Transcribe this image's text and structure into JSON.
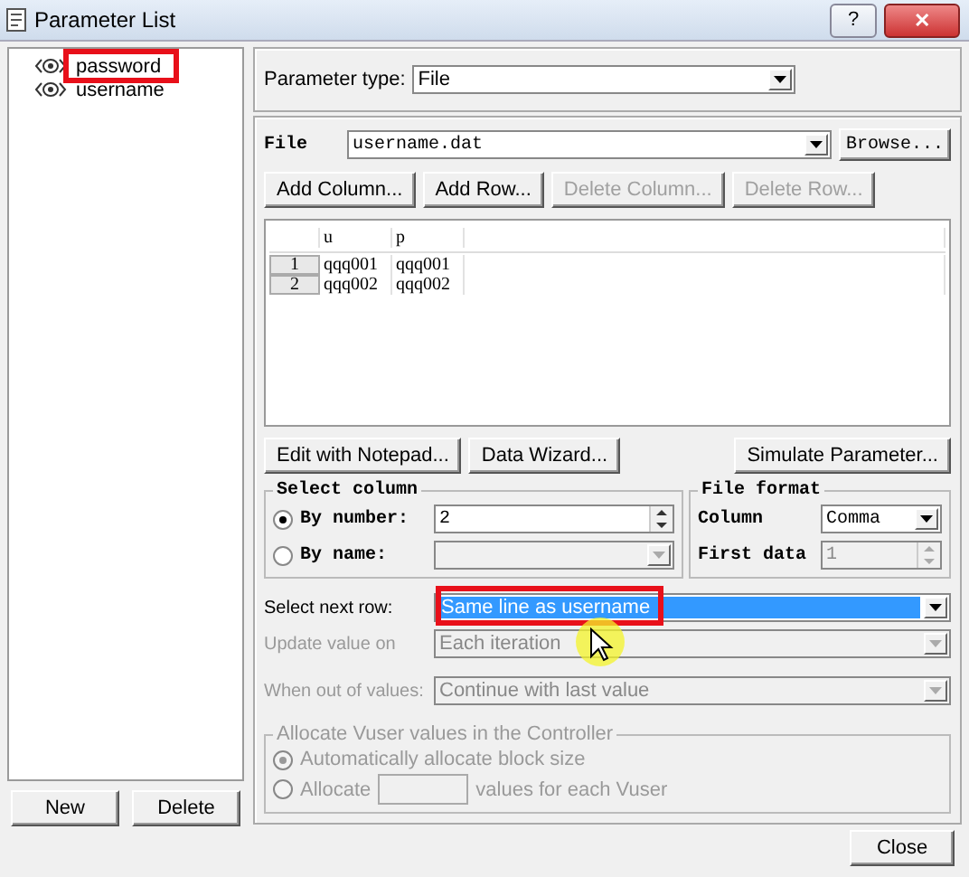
{
  "window": {
    "title": "Parameter List",
    "help_button": "?",
    "close_button": "✕"
  },
  "parameters": [
    {
      "name": "password",
      "highlighted": true
    },
    {
      "name": "username",
      "highlighted": false
    }
  ],
  "left_buttons": [
    {
      "label": "New",
      "disabled": false
    },
    {
      "label": "Delete",
      "disabled": false
    }
  ],
  "parameter_type": {
    "label": "Parameter type:",
    "value": "File"
  },
  "file": {
    "label": "File",
    "value": "username.dat",
    "browse": "Browse..."
  },
  "table_buttons": [
    {
      "label": "Add Column...",
      "disabled": false
    },
    {
      "label": "Add Row...",
      "disabled": false
    },
    {
      "label": "Delete Column...",
      "disabled": true
    },
    {
      "label": "Delete Row...",
      "disabled": true
    }
  ],
  "table": {
    "columns": [
      "u",
      "p"
    ],
    "rows": [
      {
        "number": "1",
        "cells": [
          "qqq001",
          "qqq001"
        ]
      },
      {
        "number": "2",
        "cells": [
          "qqq002",
          "qqq002"
        ]
      }
    ]
  },
  "tool_buttons": [
    {
      "label": "Edit with Notepad..."
    },
    {
      "label": "Data Wizard..."
    },
    {
      "label": "Simulate Parameter..."
    }
  ],
  "select_column": {
    "title": "Select column",
    "options": [
      {
        "label": "By number:",
        "selected": true,
        "value": "2",
        "disabled": false
      },
      {
        "label": "By name:",
        "selected": false,
        "disabled": true
      }
    ]
  },
  "file_format": {
    "title": "File format",
    "column": {
      "label": "Column",
      "value": "Comma"
    },
    "first_data": {
      "label": "First data",
      "value": "1",
      "disabled": true
    }
  },
  "options": [
    {
      "label": "Select next row:",
      "value": "Same line as username",
      "disabled": false,
      "focused": true,
      "highlighted": true
    },
    {
      "label": "Update value on",
      "value": "Each iteration",
      "disabled": true,
      "focused": false
    },
    {
      "label": "When out of values:",
      "value": "Continue with last value",
      "disabled": true,
      "focused": false
    }
  ],
  "allocate": {
    "title": "Allocate Vuser values in the Controller",
    "disabled": true,
    "options": [
      {
        "label": "Automatically allocate block size",
        "selected": true
      },
      {
        "label": "Allocate",
        "selected": false,
        "suffix": "values for each Vuser"
      }
    ]
  },
  "close_button": "Close"
}
